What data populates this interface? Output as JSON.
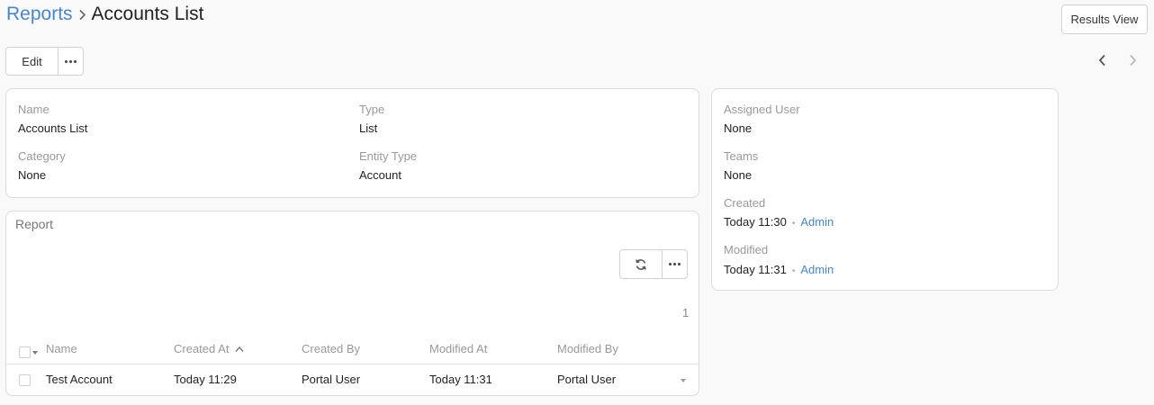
{
  "breadcrumb": {
    "parent": "Reports",
    "current": "Accounts List"
  },
  "toolbar": {
    "results_view": "Results View",
    "edit": "Edit"
  },
  "details": {
    "name_label": "Name",
    "name_value": "Accounts List",
    "type_label": "Type",
    "type_value": "List",
    "category_label": "Category",
    "category_value": "None",
    "entity_type_label": "Entity Type",
    "entity_type_value": "Account"
  },
  "side": {
    "assigned_user_label": "Assigned User",
    "assigned_user_value": "None",
    "teams_label": "Teams",
    "teams_value": "None",
    "created_label": "Created",
    "created_time": "Today 11:30",
    "created_by": "Admin",
    "modified_label": "Modified",
    "modified_time": "Today 11:31",
    "modified_by": "Admin"
  },
  "report": {
    "title": "Report",
    "count": "1",
    "columns": [
      "Name",
      "Created At",
      "Created By",
      "Modified At",
      "Modified By"
    ],
    "rows": [
      {
        "name": "Test Account",
        "created_at": "Today 11:29",
        "created_by": "Portal User",
        "modified_at": "Today 11:31",
        "modified_by": "Portal User"
      }
    ]
  },
  "icons": [
    "chevron-right-icon",
    "more-icon",
    "chevron-left-icon",
    "refresh-icon",
    "sort-asc-icon",
    "caret-down-icon"
  ],
  "colors": {
    "link": "#4a86c5",
    "background": "#f9f9f9"
  }
}
